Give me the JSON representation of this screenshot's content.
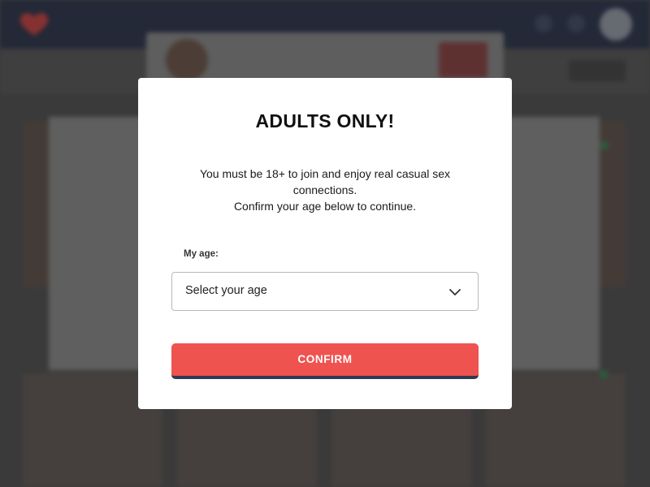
{
  "modal": {
    "title": "ADULTS ONLY!",
    "body_lines": [
      "You must be 18+ to join and enjoy real casual sex",
      "connections.",
      "Confirm your age below to continue."
    ],
    "age_label": "My age:",
    "age_select": {
      "placeholder": "Select your age",
      "chevron_icon": "chevron-down-icon"
    },
    "confirm_label": "CONFIRM"
  },
  "colors": {
    "confirm_button": "#ef5350",
    "confirm_button_border": "#2f3a52",
    "topbar": "#1f2a44",
    "logo": "#d33a3a"
  },
  "icons": {
    "logo": "heart-logo-icon",
    "avatar": "user-avatar"
  }
}
